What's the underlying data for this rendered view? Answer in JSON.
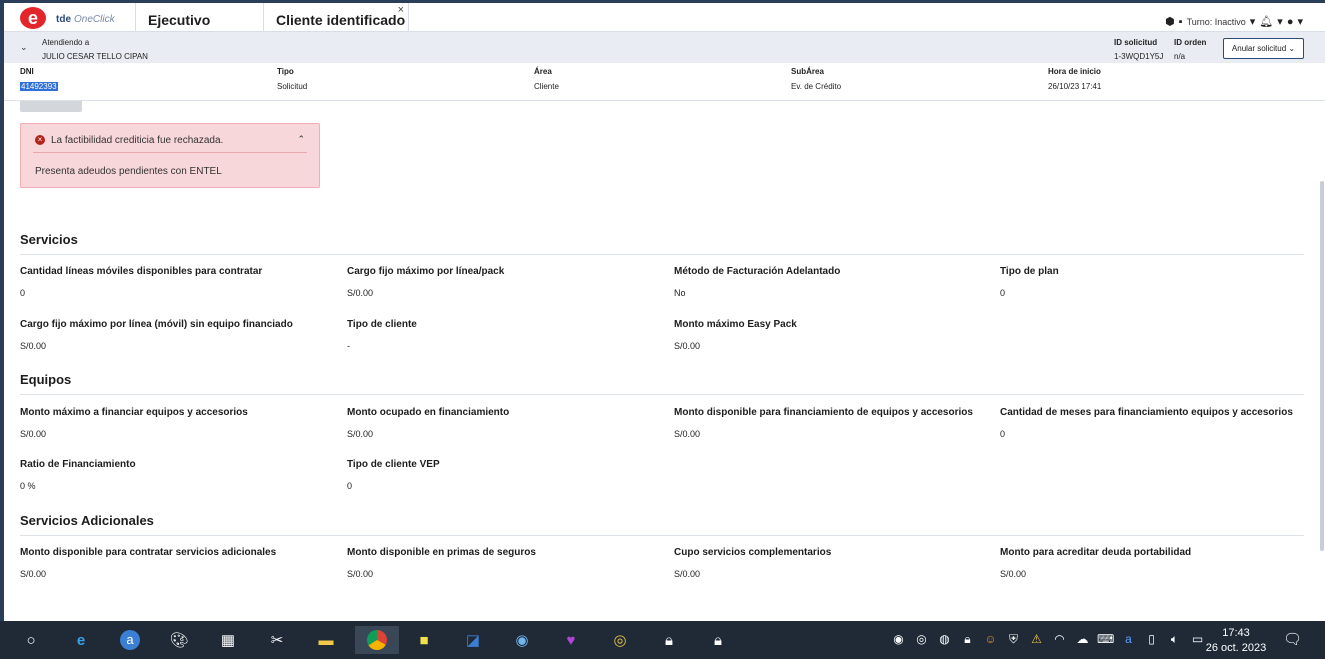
{
  "topbar": {
    "brand": "tde",
    "brand_sub": "OneClick",
    "tabs": [
      {
        "label": "Ejecutivo"
      },
      {
        "label": "Cliente identificado"
      }
    ],
    "tab_close": "×",
    "turno": "Turno: Inactivo"
  },
  "attending": {
    "label": "Atendiendo a",
    "name": "JULIO CESAR TELLO CIPAN",
    "id_solicitud_label": "ID solicitud",
    "id_solicitud": "1-3WQD1Y5J",
    "id_orden_label": "ID orden",
    "id_orden": "n/a",
    "anular_label": "Anular solicitud"
  },
  "info": {
    "dni_label": "DNI",
    "dni": "41492393",
    "tipo_label": "Tipo",
    "tipo": "Solicitud",
    "area_label": "Área",
    "area": "Cliente",
    "subarea_label": "SubÁrea",
    "subarea": "Ev. de Crédito",
    "hora_label": "Hora de inicio",
    "hora": "26/10/23 17:41"
  },
  "alert": {
    "title": "La factibilidad crediticia fue rechazada.",
    "body": "Presenta adeudos pendientes con ENTEL"
  },
  "sections": {
    "servicios": {
      "title": "Servicios",
      "fields": [
        {
          "label": "Cantidad líneas móviles disponibles para contratar",
          "value": "0"
        },
        {
          "label": "Cargo fijo máximo por línea/pack",
          "value": "S/0.00"
        },
        {
          "label": "Método de Facturación Adelantado",
          "value": "No"
        },
        {
          "label": "Tipo de plan",
          "value": "0"
        },
        {
          "label": "Cargo fijo máximo por línea (móvil) sin equipo financiado",
          "value": "S/0.00"
        },
        {
          "label": "Tipo de cliente",
          "value": "-"
        },
        {
          "label": "Monto máximo Easy Pack",
          "value": "S/0.00"
        }
      ]
    },
    "equipos": {
      "title": "Equipos",
      "fields": [
        {
          "label": "Monto máximo a financiar equipos y accesorios",
          "value": "S/0.00"
        },
        {
          "label": "Monto ocupado en financiamiento",
          "value": "S/0.00"
        },
        {
          "label": "Monto disponible para financiamiento de equipos y accesorios",
          "value": "S/0.00"
        },
        {
          "label": "Cantidad de meses para financiamiento equipos y accesorios",
          "value": "0"
        },
        {
          "label": "Ratio de Financiamiento",
          "value": "0 %"
        },
        {
          "label": "Tipo de cliente VEP",
          "value": "0"
        }
      ]
    },
    "adicionales": {
      "title": "Servicios Adicionales",
      "fields": [
        {
          "label": "Monto disponible para contratar servicios adicionales",
          "value": "S/0.00"
        },
        {
          "label": "Monto disponible en primas de seguros",
          "value": "S/0.00"
        },
        {
          "label": "Cupo servicios complementarios",
          "value": "S/0.00"
        },
        {
          "label": "Monto para acreditar deuda portabilidad",
          "value": "S/0.00"
        }
      ]
    }
  },
  "taskbar": {
    "time": "17:43",
    "date": "26 oct. 2023"
  }
}
